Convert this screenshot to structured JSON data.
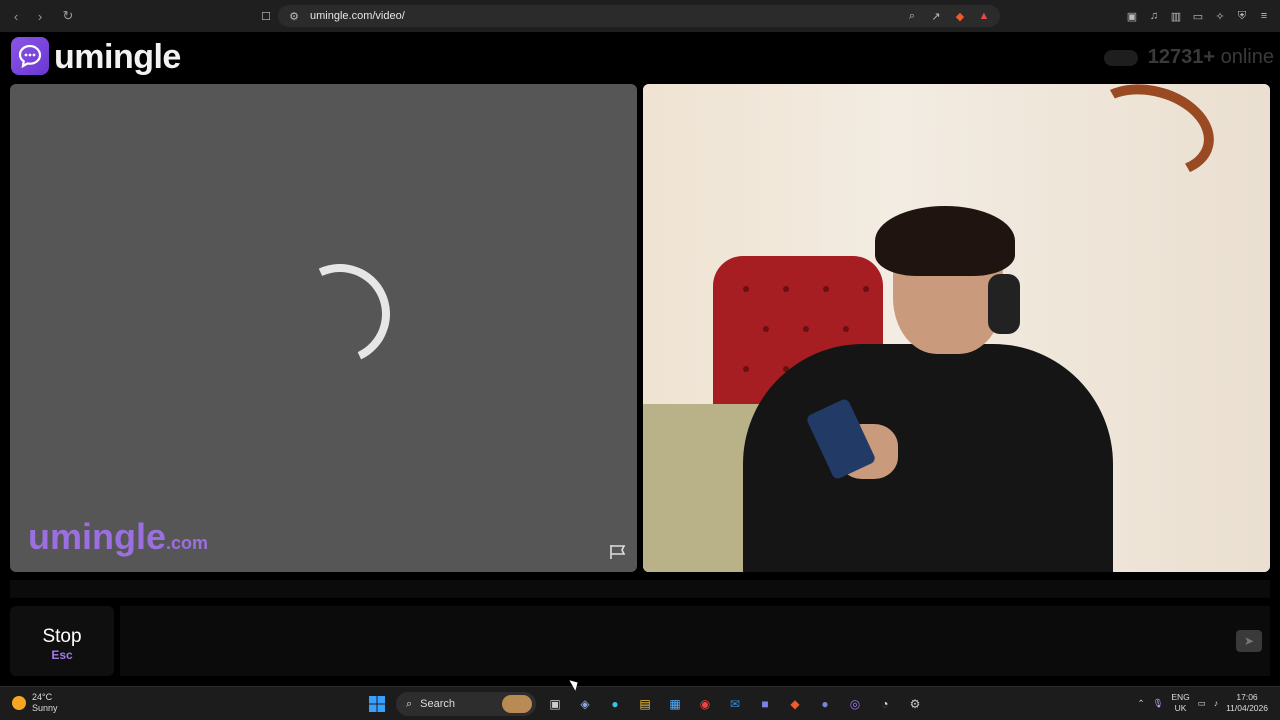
{
  "browser": {
    "url": "umingle.com/video/",
    "nav_icons": [
      "back-icon",
      "forward-icon",
      "reload-icon",
      "bookmark-icon"
    ],
    "address_icons": [
      "zoom-icon",
      "share-icon",
      "brave-shields-icon",
      "brave-rewards-icon"
    ],
    "extension_icons": [
      "tab-search-icon",
      "media-icon",
      "sidebar-icon",
      "wallet-icon",
      "leo-icon",
      "vpn-icon",
      "menu-icon"
    ]
  },
  "site": {
    "brand": "umingle",
    "online_count": "12731+",
    "online_label": "online",
    "watermark_main": "umingle",
    "watermark_domain": ".com"
  },
  "chat": {
    "stop_label": "Stop",
    "stop_key": "Esc",
    "input_value": ""
  },
  "taskbar": {
    "temperature": "24°C",
    "weather": "Sunny",
    "search_label": "Search",
    "lang_top": "ENG",
    "lang_bottom": "UK",
    "time": "17:06",
    "date": "11/04/2026"
  },
  "colors": {
    "brand_purple": "#7b45de",
    "watermark": "#9b6fe0",
    "left_pane": "#565656"
  }
}
